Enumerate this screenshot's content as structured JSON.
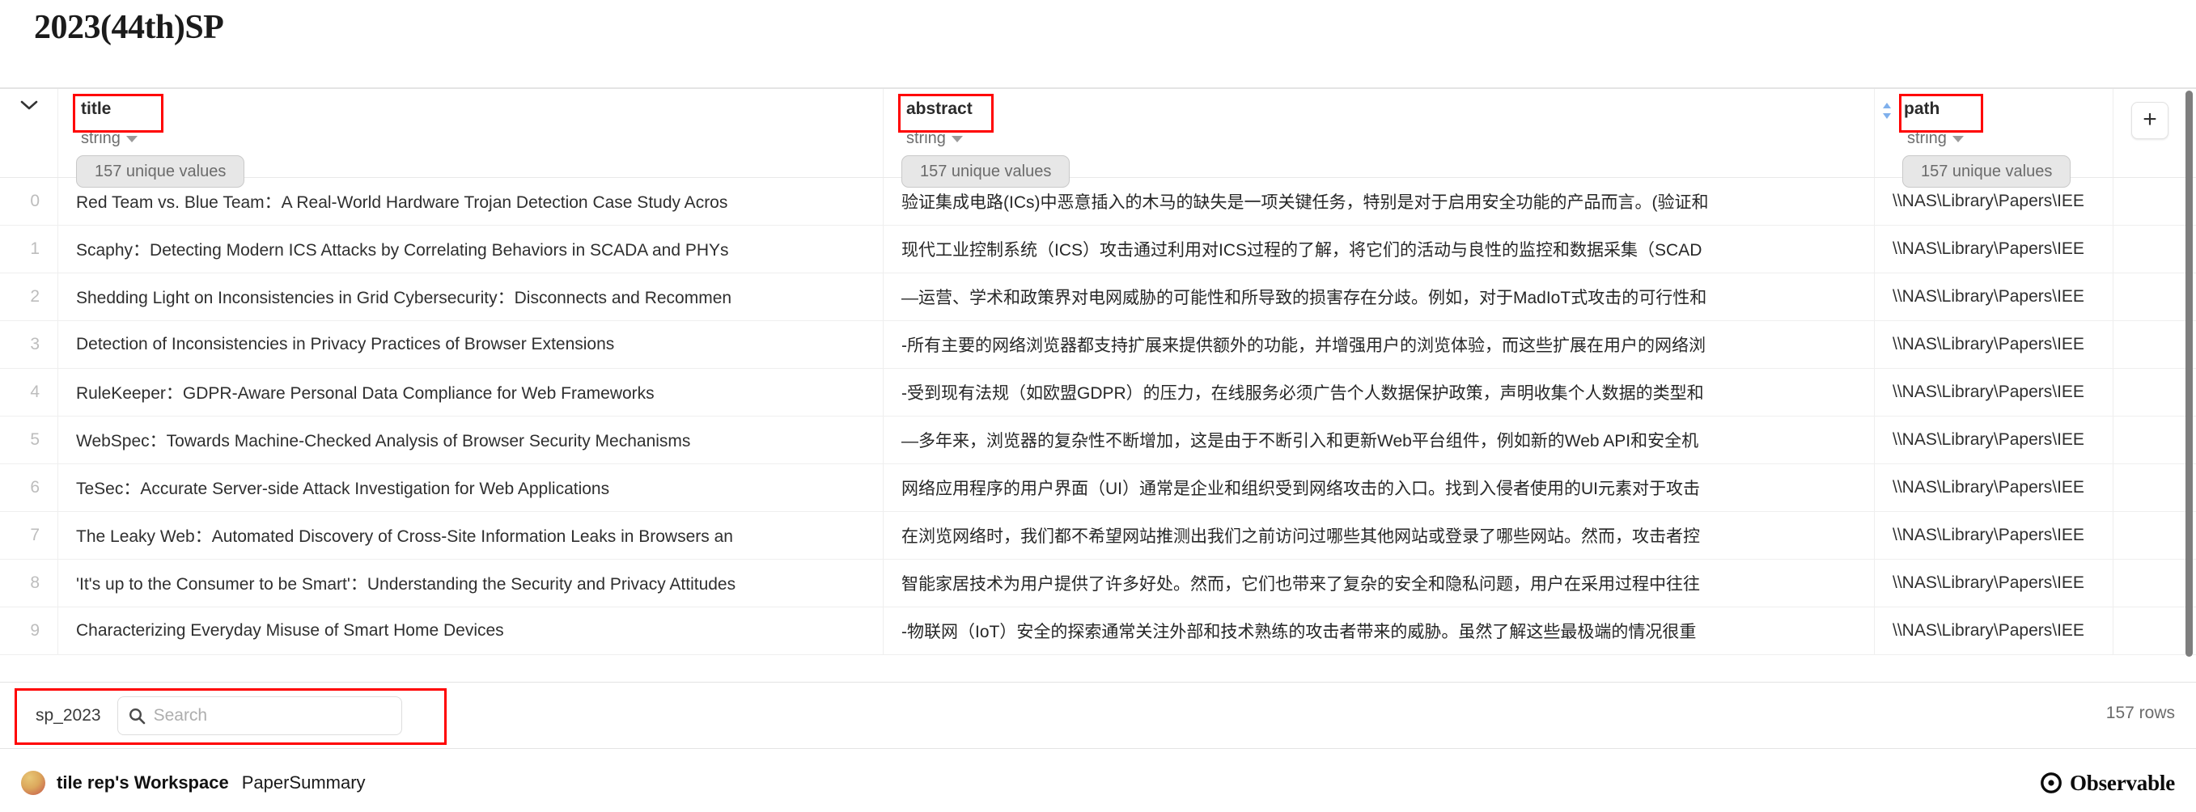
{
  "page": {
    "title": "2023(44th)SP"
  },
  "table": {
    "columns": [
      {
        "name": "title",
        "type": "string",
        "unique": "157 unique values",
        "highlighted": true,
        "sortable": false
      },
      {
        "name": "abstract",
        "type": "string",
        "unique": "157 unique values",
        "highlighted": true,
        "sortable": false
      },
      {
        "name": "path",
        "type": "string",
        "unique": "157 unique values",
        "highlighted": true,
        "sortable": true
      }
    ],
    "add_column_label": "+",
    "collapse_icon": "chevron-down-icon",
    "sort_icon": "sort-updown-icon",
    "type_caret_icon": "caret-down-icon",
    "rows": [
      {
        "index": "0",
        "title": "Red Team vs. Blue Team：A Real-World Hardware Trojan Detection Case Study Acros",
        "abstract": "验证集成电路(ICs)中恶意插入的木马的缺失是一项关键任务，特别是对于启用安全功能的产品而言。(验证和",
        "path": "\\\\NAS\\Library\\Papers\\IEE"
      },
      {
        "index": "1",
        "title": "Scaphy：Detecting Modern ICS Attacks by Correlating Behaviors in SCADA and PHYs",
        "abstract": "现代工业控制系统（ICS）攻击通过利用对ICS过程的了解，将它们的活动与良性的监控和数据采集（SCAD",
        "path": "\\\\NAS\\Library\\Papers\\IEE"
      },
      {
        "index": "2",
        "title": "Shedding Light on Inconsistencies in Grid Cybersecurity：Disconnects and Recommen",
        "abstract": "—运营、学术和政策界对电网威胁的可能性和所导致的损害存在分歧。例如，对于MadIoT式攻击的可行性和",
        "path": "\\\\NAS\\Library\\Papers\\IEE"
      },
      {
        "index": "3",
        "title": "Detection of Inconsistencies in Privacy Practices of Browser Extensions",
        "abstract": "-所有主要的网络浏览器都支持扩展来提供额外的功能，并增强用户的浏览体验，而这些扩展在用户的网络浏",
        "path": "\\\\NAS\\Library\\Papers\\IEE"
      },
      {
        "index": "4",
        "title": "RuleKeeper：GDPR-Aware Personal Data Compliance for Web Frameworks",
        "abstract": "-受到现有法规（如欧盟GDPR）的压力，在线服务必须广告个人数据保护政策，声明收集个人数据的类型和",
        "path": "\\\\NAS\\Library\\Papers\\IEE"
      },
      {
        "index": "5",
        "title": "WebSpec：Towards Machine-Checked Analysis of Browser Security Mechanisms",
        "abstract": "—多年来，浏览器的复杂性不断增加，这是由于不断引入和更新Web平台组件，例如新的Web API和安全机",
        "path": "\\\\NAS\\Library\\Papers\\IEE"
      },
      {
        "index": "6",
        "title": "TeSec：Accurate Server-side Attack Investigation for Web Applications",
        "abstract": "网络应用程序的用户界面（UI）通常是企业和组织受到网络攻击的入口。找到入侵者使用的UI元素对于攻击",
        "path": "\\\\NAS\\Library\\Papers\\IEE"
      },
      {
        "index": "7",
        "title": "The Leaky Web：Automated Discovery of Cross-Site Information Leaks in Browsers an",
        "abstract": "在浏览网络时，我们都不希望网站推测出我们之前访问过哪些其他网站或登录了哪些网站。然而，攻击者控",
        "path": "\\\\NAS\\Library\\Papers\\IEE"
      },
      {
        "index": "8",
        "title": "'It's up to the Consumer to be Smart'：Understanding the Security and Privacy Attitudes",
        "abstract": "智能家居技术为用户提供了许多好处。然而，它们也带来了复杂的安全和隐私问题，用户在采用过程中往往",
        "path": "\\\\NAS\\Library\\Papers\\IEE"
      },
      {
        "index": "9",
        "title": "Characterizing Everyday Misuse of Smart Home Devices",
        "abstract": "-物联网（IoT）安全的探索通常关注外部和技术熟练的攻击者带来的威胁。虽然了解这些最极端的情况很重",
        "path": "\\\\NAS\\Library\\Papers\\IEE"
      }
    ]
  },
  "footer": {
    "table_name": "sp_2023",
    "search_placeholder": "Search",
    "search_value": "",
    "search_icon": "search-icon",
    "rows_count": "157 rows"
  },
  "credit": {
    "avatar": "user-avatar",
    "workspace": "tile rep's Workspace",
    "notebook": "PaperSummary",
    "brand_icon": "observable-logo-icon",
    "brand": "Observable"
  },
  "colors": {
    "highlight": "#ff0000",
    "accent": "#6fa8ea",
    "text": "#2f2f2f",
    "muted": "#6b6b6b",
    "border": "#eeeeee"
  }
}
